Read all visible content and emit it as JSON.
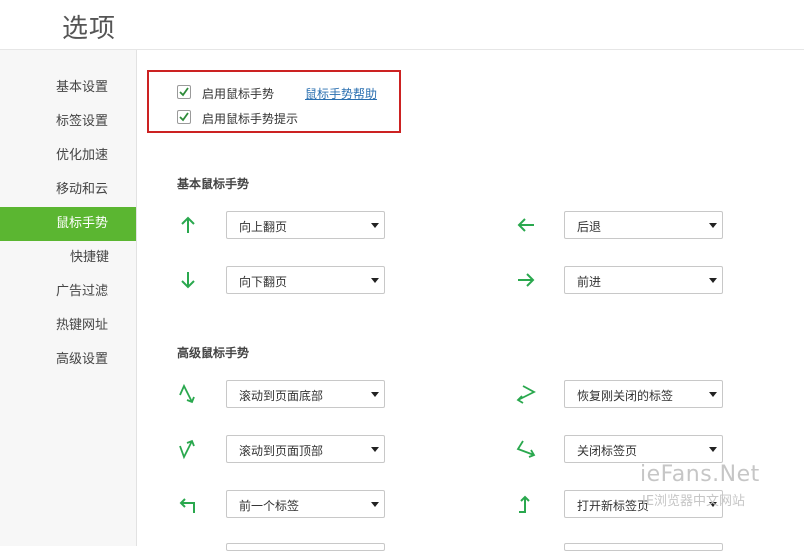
{
  "window": {
    "title": "选项"
  },
  "sidebar": {
    "items": [
      {
        "label": "基本设置"
      },
      {
        "label": "标签设置"
      },
      {
        "label": "优化加速"
      },
      {
        "label": "移动和云"
      },
      {
        "label": "鼠标手势",
        "active": true
      },
      {
        "label": "快捷键"
      },
      {
        "label": "广告过滤"
      },
      {
        "label": "热键网址"
      },
      {
        "label": "高级设置"
      }
    ]
  },
  "options": {
    "enable_gestures": {
      "label": "启用鼠标手势",
      "checked": true
    },
    "enable_gesture_hints": {
      "label": "启用鼠标手势提示",
      "checked": true
    },
    "help_link": "鼠标手势帮助"
  },
  "basic": {
    "title": "基本鼠标手势",
    "gestures": [
      {
        "icon": "arrow-up-icon",
        "value": "向上翻页"
      },
      {
        "icon": "arrow-left-icon",
        "value": "后退"
      },
      {
        "icon": "arrow-down-icon",
        "value": "向下翻页"
      },
      {
        "icon": "arrow-right-icon",
        "value": "前进"
      }
    ]
  },
  "advanced": {
    "title": "高级鼠标手势",
    "gestures": [
      {
        "icon": "up-down-gesture-icon",
        "value": "滚动到页面底部"
      },
      {
        "icon": "right-left-gesture-icon",
        "value": "恢复刚关闭的标签"
      },
      {
        "icon": "down-up-gesture-icon",
        "value": "滚动到页面顶部"
      },
      {
        "icon": "left-right-gesture-icon",
        "value": "关闭标签页"
      },
      {
        "icon": "left-turn-arrow-icon",
        "value": "前一个标签"
      },
      {
        "icon": "up-turn-arrow-icon",
        "value": "打开新标签页"
      }
    ]
  },
  "watermark": {
    "brand": "ieFans.Net",
    "subtitle": "IE浏览器中文网站"
  },
  "colors": {
    "accent": "#5bb631",
    "arrow": "#2aa84e",
    "highlight_border": "#cc2222",
    "link": "#2a6fb0"
  }
}
